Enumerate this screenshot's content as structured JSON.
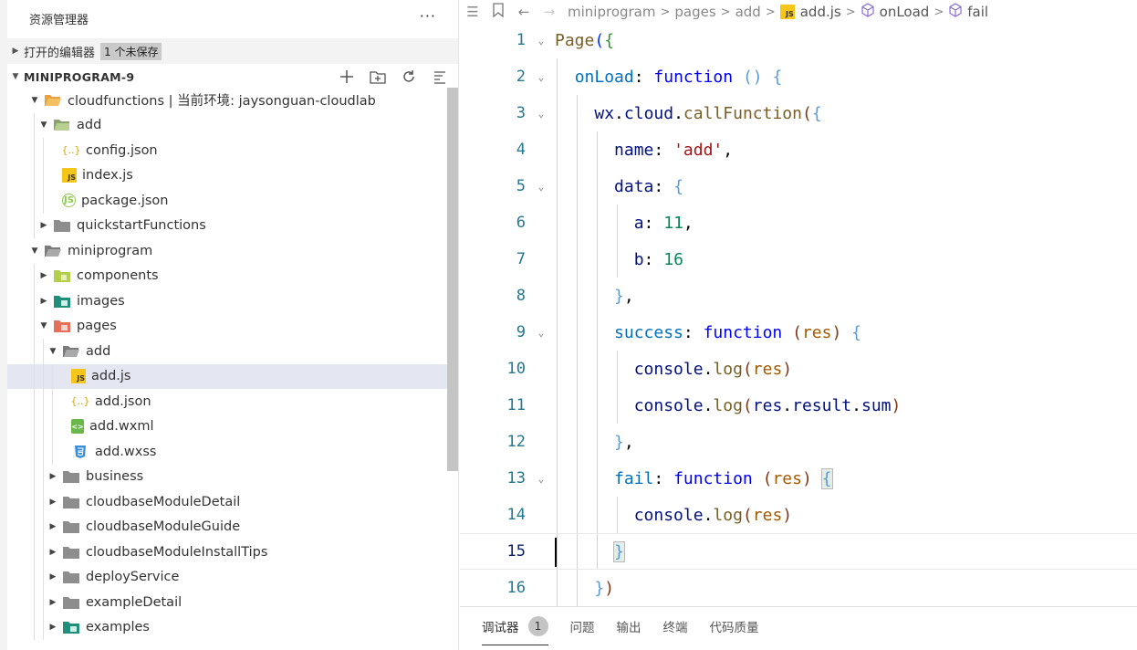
{
  "explorer": {
    "title": "资源管理器",
    "more_label": "···",
    "open_editors": {
      "label": "打开的编辑器",
      "badge": "1 个未保存"
    },
    "project": {
      "label": "MINIPROGRAM-9"
    },
    "tree": [
      {
        "label": "cloudfunctions | 当前环境: jaysonguan-cloudlab",
        "icon": "folder-open-icon"
      },
      {
        "label": "add",
        "icon": "folder-open-icon"
      },
      {
        "label": "config.json",
        "icon": "json-icon"
      },
      {
        "label": "index.js",
        "icon": "js-icon"
      },
      {
        "label": "package.json",
        "icon": "package-icon"
      },
      {
        "label": "quickstartFunctions",
        "icon": "folder-icon"
      },
      {
        "label": "miniprogram",
        "icon": "folder-open-icon"
      },
      {
        "label": "components",
        "icon": "folder-icon"
      },
      {
        "label": "images",
        "icon": "folder-icon"
      },
      {
        "label": "pages",
        "icon": "folder-icon"
      },
      {
        "label": "add",
        "icon": "folder-open-icon"
      },
      {
        "label": "add.js",
        "icon": "js-icon"
      },
      {
        "label": "add.json",
        "icon": "json-icon"
      },
      {
        "label": "add.wxml",
        "icon": "wxml-icon"
      },
      {
        "label": "add.wxss",
        "icon": "wxss-icon"
      },
      {
        "label": "business",
        "icon": "folder-icon"
      },
      {
        "label": "cloudbaseModuleDetail",
        "icon": "folder-icon"
      },
      {
        "label": "cloudbaseModuleGuide",
        "icon": "folder-icon"
      },
      {
        "label": "cloudbaseModuleInstallTips",
        "icon": "folder-icon"
      },
      {
        "label": "deployService",
        "icon": "folder-icon"
      },
      {
        "label": "exampleDetail",
        "icon": "folder-icon"
      },
      {
        "label": "examples",
        "icon": "folder-icon"
      }
    ]
  },
  "breadcrumb": {
    "items": [
      "miniprogram",
      "pages",
      "add",
      "add.js",
      "onLoad",
      "fail"
    ]
  },
  "editor": {
    "line_numbers": [
      "1",
      "2",
      "3",
      "4",
      "5",
      "6",
      "7",
      "8",
      "9",
      "10",
      "11",
      "12",
      "13",
      "14",
      "15",
      "16"
    ],
    "active_line": "15"
  },
  "panel": {
    "tabs": [
      "调试器",
      "问题",
      "输出",
      "终端",
      "代码质量"
    ],
    "debugger_count": "1"
  },
  "colors": {
    "keyword": "#0000ff",
    "string": "#a31515",
    "number": "#098658",
    "selected_row": "#e4e6f1",
    "line_number": "#237893"
  }
}
